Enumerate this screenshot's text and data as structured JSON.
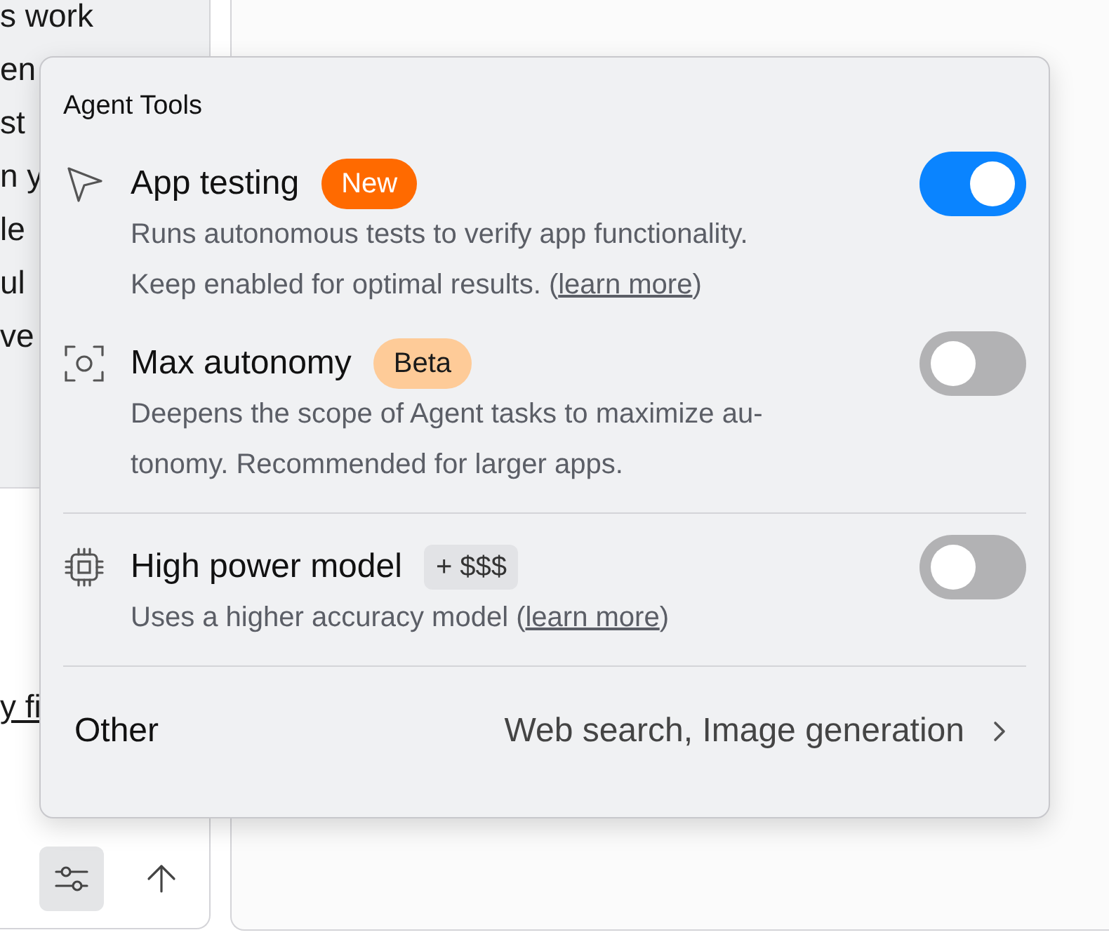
{
  "background_lines": [
    "s work",
    "en",
    "st",
    "n y",
    "le",
    "ul",
    "ve"
  ],
  "background_link": "y fi",
  "toolbar_buttons": [
    {
      "kind": "settings",
      "selected": true
    },
    {
      "kind": "send",
      "selected": false
    }
  ],
  "popup": {
    "title": "Agent Tools",
    "sections": [
      [
        {
          "kind": "cursor",
          "title": "App testing",
          "badge": {
            "kind": "new",
            "text": "New"
          },
          "on": true,
          "lines": [
            {
              "text": "Runs autonomous tests to verify app functionality."
            },
            {
              "text": "Keep enabled for optimal results. (",
              "link": "learn more",
              "after": ")"
            }
          ]
        },
        {
          "kind": "focus",
          "title": "Max autonomy",
          "badge": {
            "kind": "beta",
            "text": "Beta"
          },
          "on": false,
          "lines": [
            {
              "text": "Deepens the scope of Agent tasks to maximize au-"
            },
            {
              "text": "tonomy. Recommended for larger apps."
            }
          ]
        }
      ],
      [
        {
          "kind": "chip",
          "title": "High power model",
          "badge": {
            "kind": "price",
            "text": "+ $$$"
          },
          "on": false,
          "lines": [
            {
              "text": "Uses a higher accuracy model (",
              "link": "learn more",
              "after": ")"
            }
          ]
        }
      ]
    ],
    "other": {
      "label": "Other",
      "value": "Web search, Image generation"
    }
  }
}
